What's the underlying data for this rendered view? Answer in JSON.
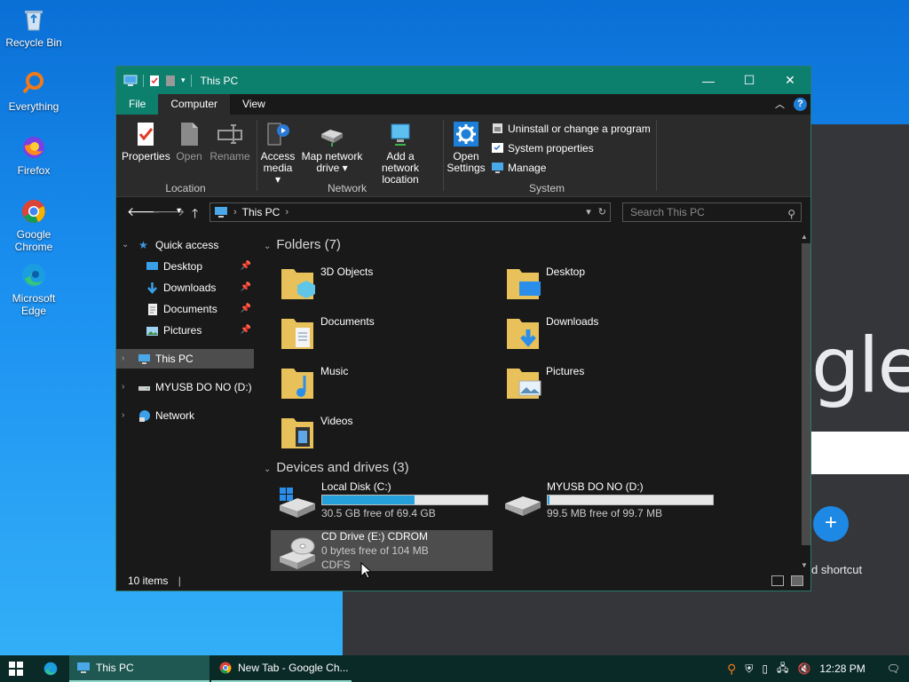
{
  "desktop": {
    "icons": [
      {
        "label": "Recycle Bin"
      },
      {
        "label": "Everything"
      },
      {
        "label": "Firefox"
      },
      {
        "label": "Google Chrome"
      },
      {
        "label": "Microsoft Edge"
      }
    ]
  },
  "chrome_bg": {
    "logo_text": "gle",
    "plus": "+",
    "shortcut_label": "d shortcut"
  },
  "window": {
    "title": "This PC",
    "tabs": {
      "file": "File",
      "computer": "Computer",
      "view": "View"
    },
    "help": "?"
  },
  "ribbon": {
    "location": {
      "label": "Location",
      "properties": "Properties",
      "open": "Open",
      "rename": "Rename"
    },
    "network": {
      "label": "Network",
      "access_media_l1": "Access",
      "access_media_l2": "media ▾",
      "map_drive_l1": "Map network",
      "map_drive_l2": "drive ▾",
      "add_location_l1": "Add a network",
      "add_location_l2": "location"
    },
    "system": {
      "label": "System",
      "open_settings_l1": "Open",
      "open_settings_l2": "Settings",
      "uninstall": "Uninstall or change a program",
      "system_properties": "System properties",
      "manage": "Manage"
    }
  },
  "address": {
    "path": "This PC",
    "search_placeholder": "Search This PC"
  },
  "nav": {
    "quick_access": "Quick access",
    "desktop": "Desktop",
    "downloads": "Downloads",
    "documents": "Documents",
    "pictures": "Pictures",
    "this_pc": "This PC",
    "usb": "MYUSB DO NO (D:)",
    "network": "Network"
  },
  "content": {
    "folders_header": "Folders (7)",
    "folders": [
      "3D Objects",
      "Desktop",
      "Documents",
      "Downloads",
      "Music",
      "Pictures",
      "Videos"
    ],
    "drives_header": "Devices and drives (3)",
    "drives": [
      {
        "name": "Local Disk (C:)",
        "free": "30.5 GB free of 69.4 GB",
        "used_fraction": 0.56
      },
      {
        "name": "MYUSB DO NO (D:)",
        "free": "99.5 MB free of 99.7 MB",
        "used_fraction": 0.01
      },
      {
        "name": "CD Drive (E:) CDROM",
        "free": "0 bytes free of 104 MB",
        "fs": "CDFS"
      }
    ]
  },
  "status": {
    "items": "10 items"
  },
  "taskbar": {
    "explorer_label": "This PC",
    "chrome_label": "New Tab - Google Ch...",
    "time": "12:28 PM"
  },
  "colors": {
    "titlebar": "#0d7f6d",
    "accent_blue": "#26a0da",
    "selection": "#4d4d4d"
  }
}
